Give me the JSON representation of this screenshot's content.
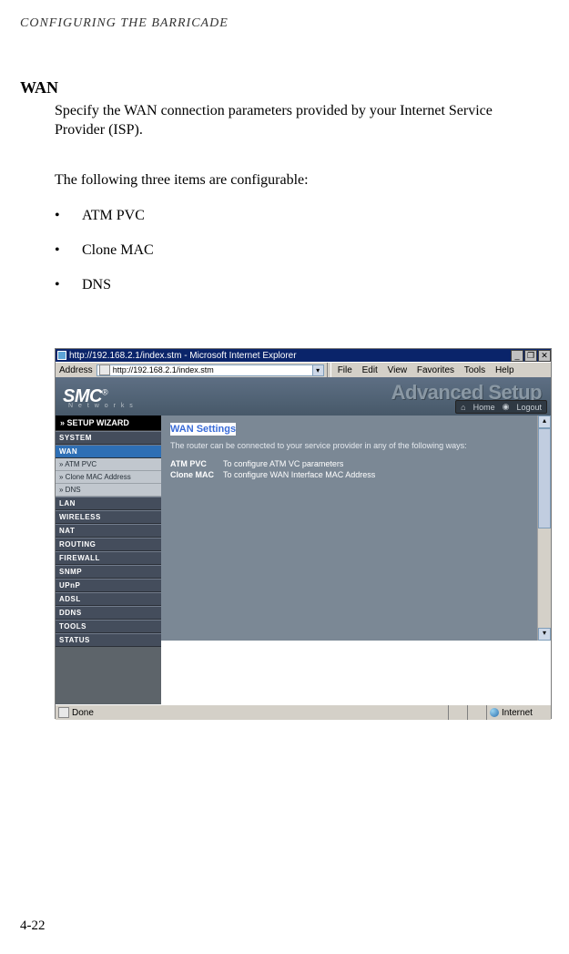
{
  "header": "CONFIGURING THE BARRICADE",
  "section_title": "WAN",
  "para1": "Specify the WAN connection parameters provided by your Internet Service Provider (ISP).",
  "para2": "The following three items are configurable:",
  "bullets": [
    "ATM PVC",
    "Clone MAC",
    "DNS"
  ],
  "page_number": "4-22",
  "screenshot": {
    "window_title": "http://192.168.2.1/index.stm - Microsoft Internet Explorer",
    "win_buttons": {
      "min": "_",
      "max": "❐",
      "close": "✕"
    },
    "address_label": "Address",
    "address_value": "http://192.168.2.1/index.stm",
    "menus": [
      "File",
      "Edit",
      "View",
      "Favorites",
      "Tools",
      "Help"
    ],
    "logo": "SMC",
    "logo_reg": "®",
    "networks": "N e t w o r k s",
    "advanced": "Advanced Setup",
    "home": "Home",
    "logout": "Logout",
    "sidebar": {
      "wizard": "» SETUP WIZARD",
      "items": [
        {
          "label": "SYSTEM",
          "type": "cat"
        },
        {
          "label": "WAN",
          "type": "cat-active"
        },
        {
          "label": "» ATM PVC",
          "type": "sub"
        },
        {
          "label": "» Clone MAC Address",
          "type": "sub"
        },
        {
          "label": "» DNS",
          "type": "sub"
        },
        {
          "label": "LAN",
          "type": "cat"
        },
        {
          "label": "WIRELESS",
          "type": "cat"
        },
        {
          "label": "NAT",
          "type": "cat"
        },
        {
          "label": "ROUTING",
          "type": "cat"
        },
        {
          "label": "FIREWALL",
          "type": "cat"
        },
        {
          "label": "SNMP",
          "type": "cat"
        },
        {
          "label": "UPnP",
          "type": "cat"
        },
        {
          "label": "ADSL",
          "type": "cat"
        },
        {
          "label": "DDNS",
          "type": "cat"
        },
        {
          "label": "TOOLS",
          "type": "cat"
        },
        {
          "label": "STATUS",
          "type": "cat"
        }
      ]
    },
    "content": {
      "title": "WAN Settings",
      "blurb": "The router can be connected to your service provider in any of the following ways:",
      "rows": [
        {
          "k": "ATM PVC",
          "v": "To configure ATM VC parameters"
        },
        {
          "k": "Clone MAC",
          "v": "To configure WAN Interface MAC Address"
        }
      ]
    },
    "status": {
      "done": "Done",
      "zone": "Internet"
    }
  }
}
